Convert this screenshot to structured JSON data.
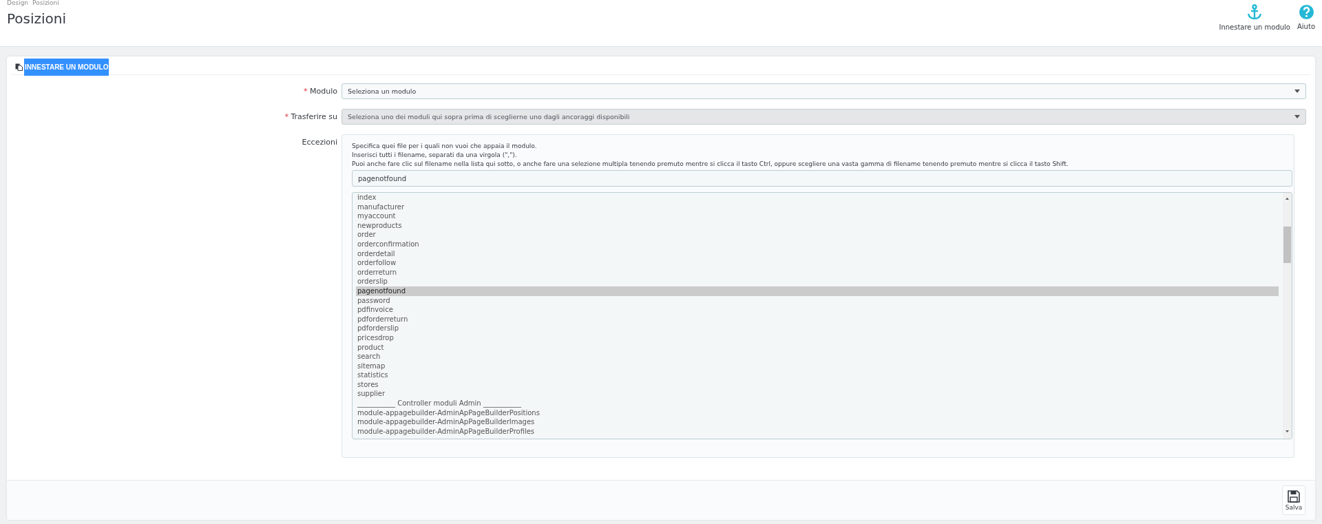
{
  "breadcrumb": [
    "Design",
    "Posizioni"
  ],
  "title": "Posizioni",
  "toolbar": [
    {
      "kind": "anchor",
      "label": "Innestare un modulo"
    },
    {
      "kind": "help",
      "label": "Aiuto"
    }
  ],
  "panel": {
    "heading": "INNESTARE UN MODULO",
    "fields": [
      {
        "label": "Modulo",
        "required_mark": "*",
        "value": "Seleziona un modulo",
        "disabled": false
      },
      {
        "label": "Trasferire su",
        "required_mark": "*",
        "value": "Seleziona uno dei moduli qui sopra prima di sceglierne uno dagli ancoraggi disponibili",
        "disabled": true
      }
    ],
    "exceptions": {
      "label": "Eccezioni",
      "help": [
        "Specifica quei file per i quali non vuoi che appaia il modulo.",
        "Inserisci tutti i filename, separati da una virgola (\",\").",
        "Puoi anche fare clic sul filename nella lista qui sotto, o anche fare una selezione multipla tenendo premuto mentre si clicca il tasto Ctrl, oppure scegliere una vasta gamma di filename tenendo premuto mentre si clicca il tasto Shift."
      ],
      "value": "pagenotfound",
      "items": [
        {
          "label": "index",
          "selected": false
        },
        {
          "label": "manufacturer",
          "selected": false
        },
        {
          "label": "myaccount",
          "selected": false
        },
        {
          "label": "newproducts",
          "selected": false
        },
        {
          "label": "order",
          "selected": false
        },
        {
          "label": "orderconfirmation",
          "selected": false
        },
        {
          "label": "orderdetail",
          "selected": false
        },
        {
          "label": "orderfollow",
          "selected": false
        },
        {
          "label": "orderreturn",
          "selected": false
        },
        {
          "label": "orderslip",
          "selected": false
        },
        {
          "label": "pagenotfound",
          "selected": true
        },
        {
          "label": "password",
          "selected": false
        },
        {
          "label": "pdfinvoice",
          "selected": false
        },
        {
          "label": "pdforderreturn",
          "selected": false
        },
        {
          "label": "pdforderslip",
          "selected": false
        },
        {
          "label": "pricesdrop",
          "selected": false
        },
        {
          "label": "product",
          "selected": false
        },
        {
          "label": "search",
          "selected": false
        },
        {
          "label": "sitemap",
          "selected": false
        },
        {
          "label": "statistics",
          "selected": false
        },
        {
          "label": "stores",
          "selected": false
        },
        {
          "label": "supplier",
          "selected": false
        },
        {
          "label": "___________ Controller moduli Admin ___________",
          "selected": false
        },
        {
          "label": "module-appagebuilder-AdminApPageBuilderPositions",
          "selected": false
        },
        {
          "label": "module-appagebuilder-AdminApPageBuilderImages",
          "selected": false
        },
        {
          "label": "module-appagebuilder-AdminApPageBuilderProfiles",
          "selected": false
        }
      ]
    },
    "save": "Salva"
  }
}
